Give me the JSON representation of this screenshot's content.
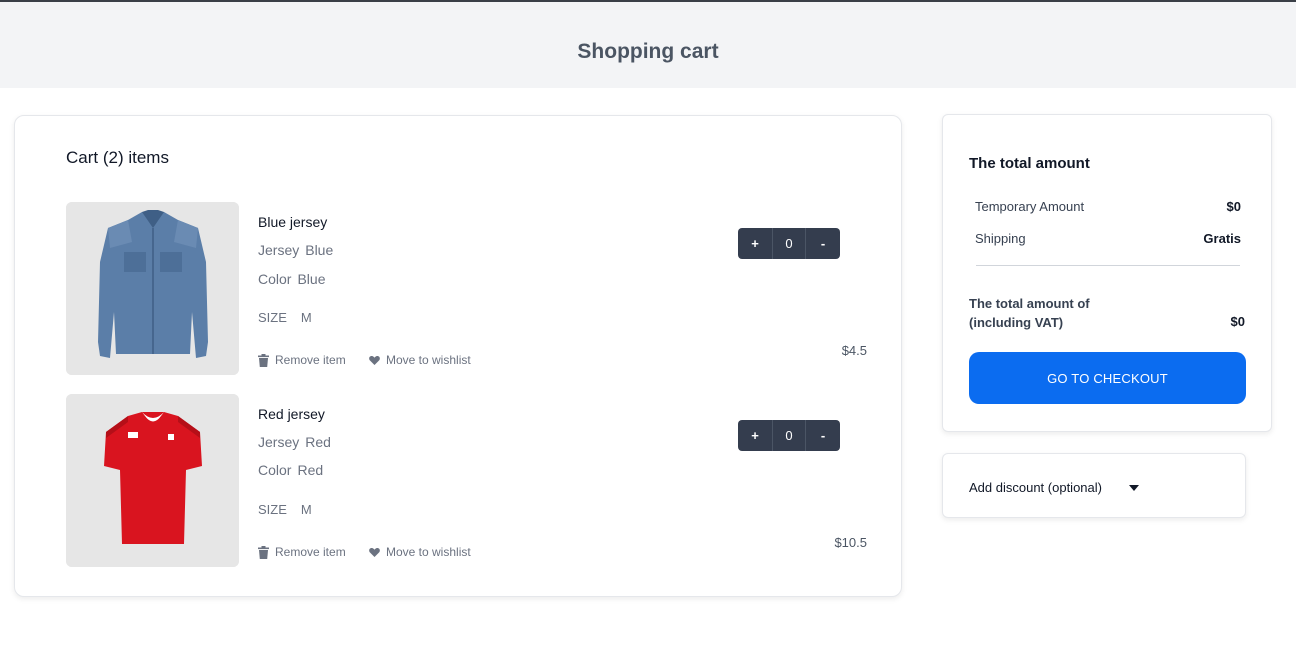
{
  "header": {
    "title": "Shopping cart"
  },
  "cart": {
    "title": "Cart (2) items",
    "items": [
      {
        "name": "Blue jersey",
        "jersey_label": "Jersey",
        "jersey_value": "Blue",
        "color_label": "Color",
        "color_value": "Blue",
        "size_label": "SIZE",
        "size_value": "M",
        "remove_label": "Remove item",
        "wishlist_label": "Move to wishlist",
        "plus": "+",
        "quantity": "0",
        "minus": "-",
        "price": "$4.5",
        "image_icon": "denim-shirt-icon",
        "color_hex": "#5b7ea8"
      },
      {
        "name": "Red jersey",
        "jersey_label": "Jersey",
        "jersey_value": "Red",
        "color_label": "Color",
        "color_value": "Red",
        "size_label": "SIZE",
        "size_value": "M",
        "remove_label": "Remove item",
        "wishlist_label": "Move to wishlist",
        "plus": "+",
        "quantity": "0",
        "minus": "-",
        "price": "$10.5",
        "image_icon": "red-jersey-icon",
        "color_hex": "#d9141f"
      }
    ]
  },
  "summary": {
    "title": "The total amount",
    "temporary_label": "Temporary Amount",
    "temporary_value": "$0",
    "shipping_label": "Shipping",
    "shipping_value": "Gratis",
    "total_label_line1": "The total amount of",
    "total_label_line2": "(including VAT)",
    "total_value": "$0",
    "checkout_label": "GO TO CHECKOUT"
  },
  "discount": {
    "label": "Add discount (optional)"
  },
  "colors": {
    "accent": "#0b6cf0",
    "stepper": "#343d4e",
    "header_bg": "#f3f4f6"
  }
}
